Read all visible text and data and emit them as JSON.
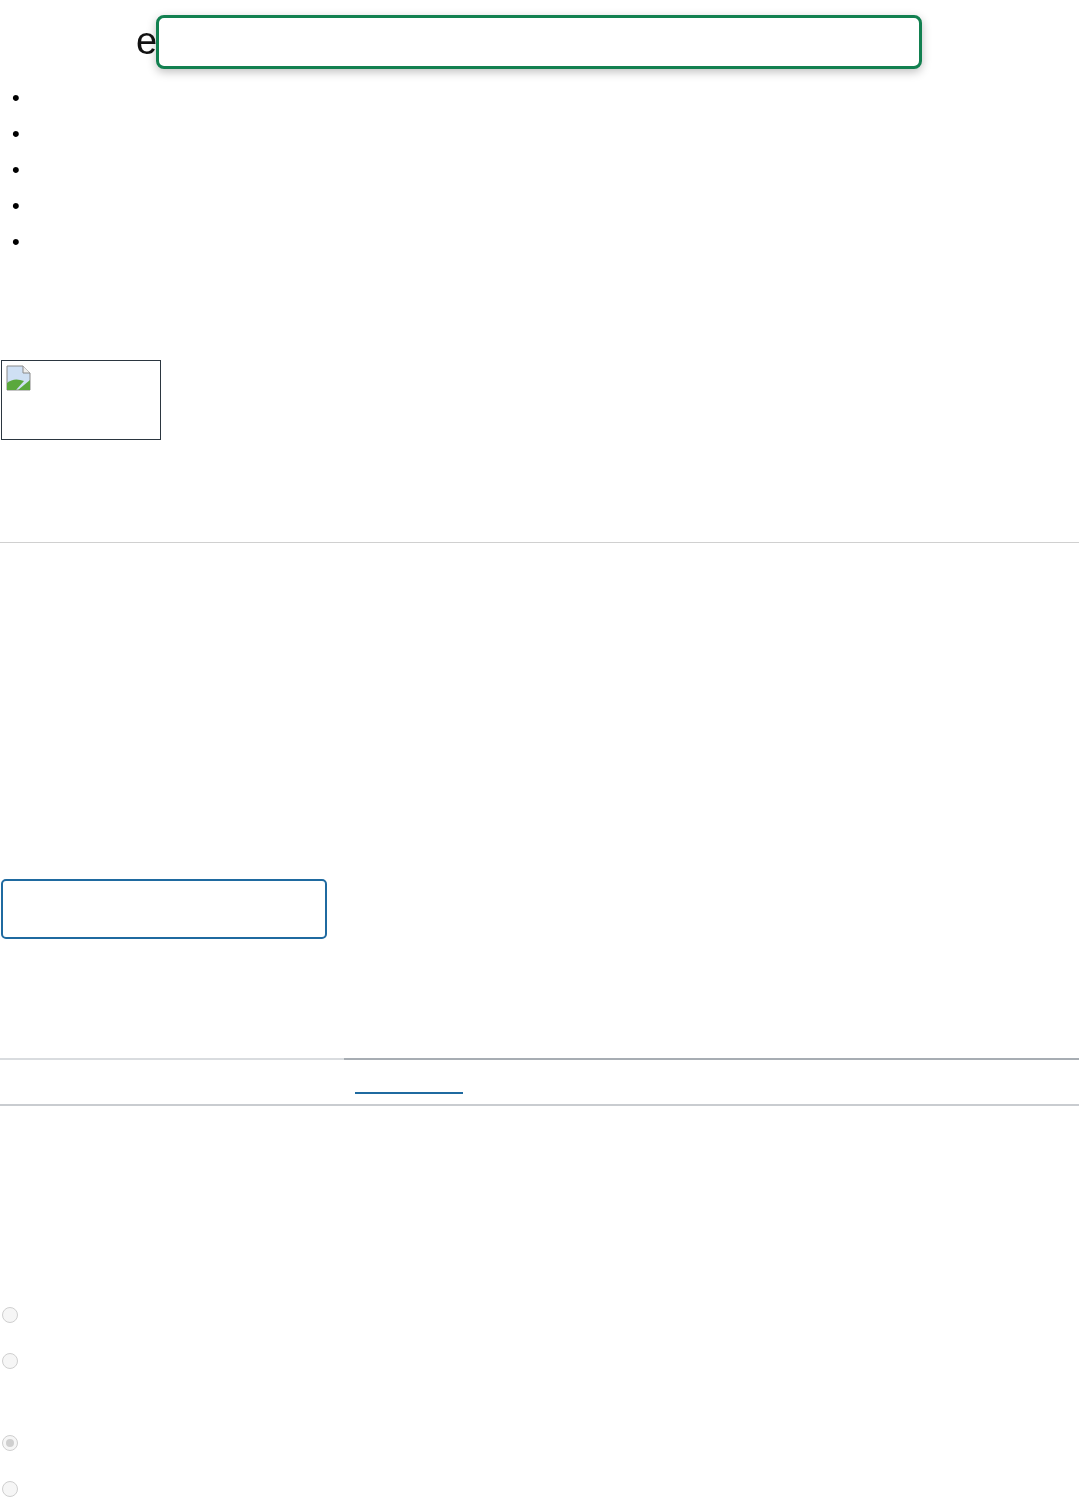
{
  "heading": {
    "text": "e"
  },
  "search": {
    "focused": true
  },
  "list_items": [
    {
      "marker": "•"
    },
    {
      "marker": "•"
    },
    {
      "marker": "•"
    },
    {
      "marker": "•"
    },
    {
      "marker": "•"
    }
  ],
  "image": {
    "kind": "broken"
  },
  "button": {
    "kind": "outline"
  },
  "tab_bar": {
    "link_underlined": true
  },
  "radio_groups": [
    [
      {
        "selected": false,
        "disabled": true
      },
      {
        "selected": false,
        "disabled": true
      }
    ],
    [
      {
        "selected": true,
        "disabled": true
      },
      {
        "selected": false,
        "disabled": true
      }
    ]
  ]
}
